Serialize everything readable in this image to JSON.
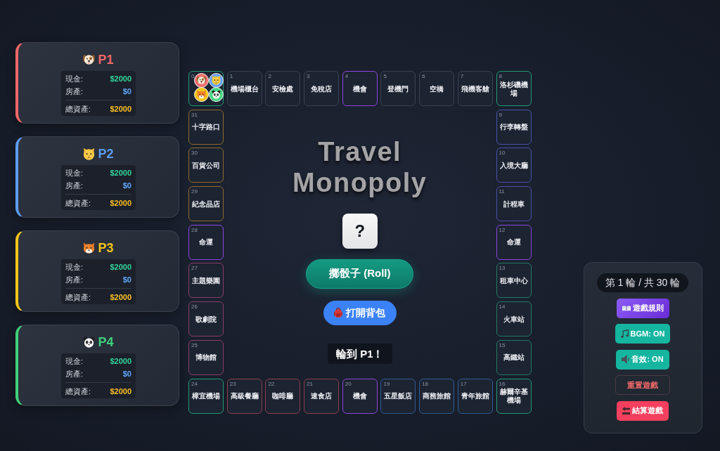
{
  "players": [
    {
      "name": "P1",
      "color": "#f06767",
      "stats": [
        {
          "kind": "cash",
          "label": "現金:",
          "value": "$2000"
        },
        {
          "kind": "property",
          "label": "房產:",
          "value": "$0"
        },
        {
          "kind": "total",
          "label": "總資產:",
          "value": "$2000"
        }
      ]
    },
    {
      "name": "P2",
      "color": "#5b9cf0",
      "stats": [
        {
          "kind": "cash",
          "label": "現金:",
          "value": "$2000"
        },
        {
          "kind": "property",
          "label": "房產:",
          "value": "$0"
        },
        {
          "kind": "total",
          "label": "總資產:",
          "value": "$2000"
        }
      ]
    },
    {
      "name": "P3",
      "color": "#f5c518",
      "stats": [
        {
          "kind": "cash",
          "label": "現金:",
          "value": "$2000"
        },
        {
          "kind": "property",
          "label": "房產:",
          "value": "$0"
        },
        {
          "kind": "total",
          "label": "總資產:",
          "value": "$2000"
        }
      ]
    },
    {
      "name": "P4",
      "color": "#3fd07a",
      "stats": [
        {
          "kind": "cash",
          "label": "現金:",
          "value": "$2000"
        },
        {
          "kind": "property",
          "label": "房產:",
          "value": "$0"
        },
        {
          "kind": "total",
          "label": "總資產:",
          "value": "$2000"
        }
      ]
    }
  ],
  "board": {
    "tiles": [
      {
        "number": "0",
        "color": "#1f9a74",
        "tokens": [
          {
            "color": "#f07070"
          },
          {
            "color": "#64a4f2"
          },
          {
            "color": "#f5c518"
          },
          {
            "color": "#4ad884"
          }
        ]
      },
      {
        "number": "1",
        "name": "機場櫃台",
        "color": "#3a4252"
      },
      {
        "number": "2",
        "name": "安檢處",
        "color": "#3a4252"
      },
      {
        "number": "3",
        "name": "免稅店",
        "color": "#3a4252"
      },
      {
        "number": "4",
        "name": "機會",
        "color": "#8e44e0"
      },
      {
        "number": "5",
        "name": "登機門",
        "color": "#3a4252"
      },
      {
        "number": "6",
        "name": "空橋",
        "color": "#3a4252"
      },
      {
        "number": "7",
        "name": "飛機客艙",
        "color": "#3a4252"
      },
      {
        "number": "8",
        "name": "洛杉磯機場",
        "color": "#1f9a74"
      },
      {
        "number": "31",
        "name": "十字路口",
        "color": "#8c6a2a"
      },
      {
        "number": "9",
        "name": "行李轉盤",
        "color": "#4a50a8"
      },
      {
        "number": "30",
        "name": "百貨公司",
        "color": "#8c6a2a"
      },
      {
        "number": "10",
        "name": "入境大廳",
        "color": "#4a50a8"
      },
      {
        "number": "29",
        "name": "紀念品店",
        "color": "#8c6a2a"
      },
      {
        "number": "11",
        "name": "計程車",
        "color": "#4a50a8"
      },
      {
        "number": "28",
        "name": "命運",
        "color": "#8e44e0"
      },
      {
        "number": "12",
        "name": "命運",
        "color": "#8e44e0"
      },
      {
        "number": "27",
        "name": "主題樂園",
        "color": "#8a3c6c"
      },
      {
        "number": "13",
        "name": "租車中心",
        "color": "#217a62"
      },
      {
        "number": "26",
        "name": "歌劇院",
        "color": "#8a3c6c"
      },
      {
        "number": "14",
        "name": "火車站",
        "color": "#217a62"
      },
      {
        "number": "25",
        "name": "博物館",
        "color": "#8a3c6c"
      },
      {
        "number": "15",
        "name": "高鐵站",
        "color": "#217a62"
      },
      {
        "number": "24",
        "name": "樟宜機場",
        "color": "#1f9a74"
      },
      {
        "number": "23",
        "name": "高級餐廳",
        "color": "#8e3e50"
      },
      {
        "number": "22",
        "name": "咖啡廳",
        "color": "#8e3e50"
      },
      {
        "number": "21",
        "name": "速食店",
        "color": "#8e3e50"
      },
      {
        "number": "20",
        "name": "機會",
        "color": "#8e44e0"
      },
      {
        "number": "19",
        "name": "五星飯店",
        "color": "#2f5c94"
      },
      {
        "number": "18",
        "name": "商務旅館",
        "color": "#2f5c94"
      },
      {
        "number": "17",
        "name": "青年旅館",
        "color": "#2f5c94"
      },
      {
        "number": "16",
        "name": "赫爾辛基機場",
        "color": "#1f9a74"
      }
    ]
  },
  "center": {
    "title": "Travel Monopoly",
    "dice": {
      "face": "?"
    },
    "roll_button": {
      "label": "擲骰子 (Roll)"
    },
    "backpack_button": {
      "label": "打開背包"
    },
    "turn_message": "輪到 P1！"
  },
  "side_panel": {
    "round": "第 1 輪 / 共 30 輪",
    "rules_button": {
      "label": "遊戲規則"
    },
    "bgm_toggle": {
      "label": "BGM: ON",
      "on": true
    },
    "sound_toggle": {
      "label": "音效: ON",
      "on": true
    },
    "reset_button": {
      "label": "重置遊戲"
    },
    "end_button": {
      "label": "結算遊戲"
    }
  }
}
